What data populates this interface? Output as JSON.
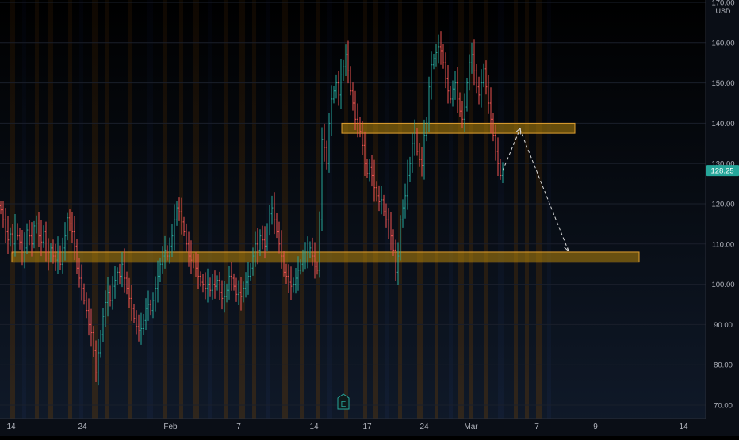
{
  "chart_data": {
    "type": "candlestick",
    "currency": "USD",
    "price_badge": "128.25",
    "y_ticks": [
      70,
      80,
      90,
      100,
      110,
      120,
      130,
      140,
      150,
      160,
      170
    ],
    "y_tick_labels": [
      "70.00",
      "80.00",
      "90.00",
      "100.00",
      "110.00",
      "120.00",
      "130.00",
      "140.00",
      "150.00",
      "160.00",
      "170.00"
    ],
    "ylim": [
      68,
      172
    ],
    "x_labels": [
      "14",
      "24",
      "Feb",
      "7",
      "14",
      "17",
      "24",
      "Mar",
      "7",
      "9",
      "14"
    ],
    "earnings_marker": "E",
    "zones": [
      {
        "name": "support",
        "low": 105.5,
        "high": 108.0
      },
      {
        "name": "resistance",
        "low": 137.5,
        "high": 140.0
      }
    ],
    "series": [
      {
        "values": [
          118.5,
          116.0,
          113.0,
          111.0,
          112.5,
          110.0,
          114.0,
          112.0,
          110.5,
          107.5,
          109.0,
          113.5,
          112.0,
          110.0,
          114.5,
          115.0,
          112.0,
          110.5,
          113.0,
          108.0,
          106.5,
          109.0,
          107.0,
          106.0,
          108.0,
          105.0,
          109.0,
          112.0,
          116.5,
          115.0,
          113.0,
          109.5,
          104.0,
          101.5,
          99.0,
          96.0,
          93.5,
          90.0,
          88.0,
          83.5,
          78.0,
          83.0,
          87.5,
          92.0,
          95.5,
          98.0,
          96.0,
          99.5,
          101.0,
          103.0,
          102.0,
          105.0,
          101.5,
          99.0,
          96.5,
          94.0,
          91.5,
          89.5,
          88.5,
          89.0,
          91.0,
          94.0,
          95.0,
          93.5,
          96.0,
          99.0,
          102.0,
          105.0,
          107.0,
          108.5,
          107.0,
          109.5,
          112.0,
          116.0,
          119.0,
          118.0,
          115.5,
          113.0,
          110.0,
          107.0,
          106.0,
          105.5,
          104.0,
          102.0,
          100.5,
          100.0,
          99.0,
          100.0,
          98.5,
          100.0,
          99.5,
          101.0,
          98.0,
          96.5,
          97.0,
          98.5,
          102.0,
          101.5,
          99.5,
          97.5,
          98.0,
          97.0,
          99.0,
          100.5,
          102.0,
          104.0,
          107.0,
          110.0,
          108.5,
          112.0,
          111.0,
          109.5,
          114.0,
          117.5,
          119.0,
          116.0,
          113.0,
          110.0,
          107.0,
          103.0,
          102.0,
          100.5,
          99.5,
          100.0,
          101.5,
          103.5,
          105.0,
          106.5,
          107.5,
          108.0,
          109.0,
          107.0,
          104.5,
          103.5,
          116.0,
          136.0,
          134.0,
          130.0,
          140.0,
          146.0,
          148.0,
          150.0,
          147.0,
          152.0,
          154.0,
          157.0,
          153.0,
          148.0,
          145.0,
          141.0,
          140.0,
          138.0,
          134.5,
          130.0,
          127.5,
          129.0,
          127.0,
          124.0,
          122.0,
          120.5,
          121.0,
          118.0,
          116.0,
          114.0,
          112.0,
          108.5,
          103.0,
          107.0,
          116.0,
          119.0,
          122.0,
          127.0,
          130.0,
          135.0,
          137.5,
          133.0,
          131.0,
          129.5,
          137.0,
          140.0,
          149.0,
          154.5,
          156.0,
          157.5,
          159.0,
          158.0,
          155.0,
          151.0,
          148.0,
          146.0,
          148.5,
          150.0,
          146.0,
          143.0,
          141.0,
          144.0,
          150.0,
          155.0,
          157.0,
          153.0,
          149.0,
          147.0,
          150.0,
          153.5,
          149.0,
          145.0,
          141.0,
          137.0,
          133.0,
          130.0,
          127.0,
          128.25
        ]
      }
    ],
    "projection": [
      {
        "step": 0,
        "value": 128.25
      },
      {
        "step": 10,
        "value": 138.5
      },
      {
        "step": 38,
        "value": 108.5
      }
    ]
  }
}
